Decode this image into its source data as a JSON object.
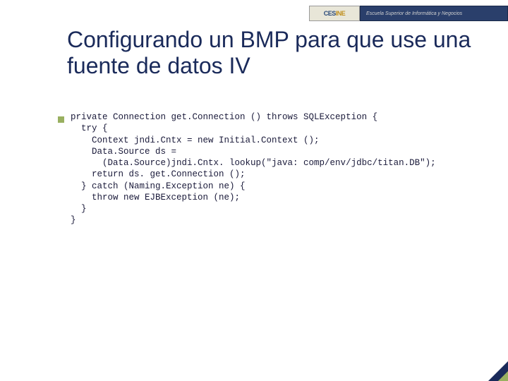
{
  "header": {
    "logo_prefix": "CES",
    "logo_accent": "INE",
    "tagline": "Escuela Superior de Informática y Negocios"
  },
  "title": "Configurando un BMP para que use una fuente de datos IV",
  "code": "private Connection get.Connection () throws SQLException {\n  try {\n    Context jndi.Cntx = new Initial.Context ();\n    Data.Source ds =\n      (Data.Source)jndi.Cntx. lookup(\"java: comp/env/jdbc/titan.DB\");\n    return ds. get.Connection ();\n  } catch (Naming.Exception ne) {\n    throw new EJBException (ne);\n  }\n}"
}
